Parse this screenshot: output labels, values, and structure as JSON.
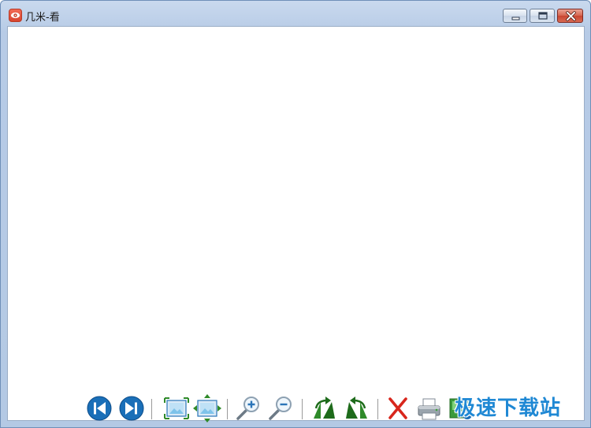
{
  "window": {
    "title": "几米-看",
    "app_icon": "eye-icon",
    "controls": {
      "minimize": "minimize-icon",
      "maximize": "maximize-icon",
      "close": "close-icon"
    }
  },
  "toolbar": {
    "buttons": [
      {
        "id": "previous",
        "icon": "skip-previous-icon"
      },
      {
        "id": "next",
        "icon": "skip-next-icon"
      },
      {
        "id": "fit-window",
        "icon": "fit-to-window-icon"
      },
      {
        "id": "actual-size",
        "icon": "actual-size-icon"
      },
      {
        "id": "zoom-in",
        "icon": "zoom-in-icon"
      },
      {
        "id": "zoom-out",
        "icon": "zoom-out-icon"
      },
      {
        "id": "rotate-clockwise",
        "icon": "rotate-right-icon"
      },
      {
        "id": "rotate-counterclockwise",
        "icon": "rotate-left-icon"
      },
      {
        "id": "delete",
        "icon": "delete-icon"
      },
      {
        "id": "print",
        "icon": "print-icon"
      },
      {
        "id": "set-wallpaper",
        "icon": "wallpaper-icon"
      }
    ]
  },
  "watermark": {
    "text": "极速下载站"
  },
  "colors": {
    "accent_blue": "#1a6fb8",
    "arrow_green": "#2f8a2a",
    "delete_red": "#d8261c",
    "watermark_blue": "#1f88d4"
  }
}
